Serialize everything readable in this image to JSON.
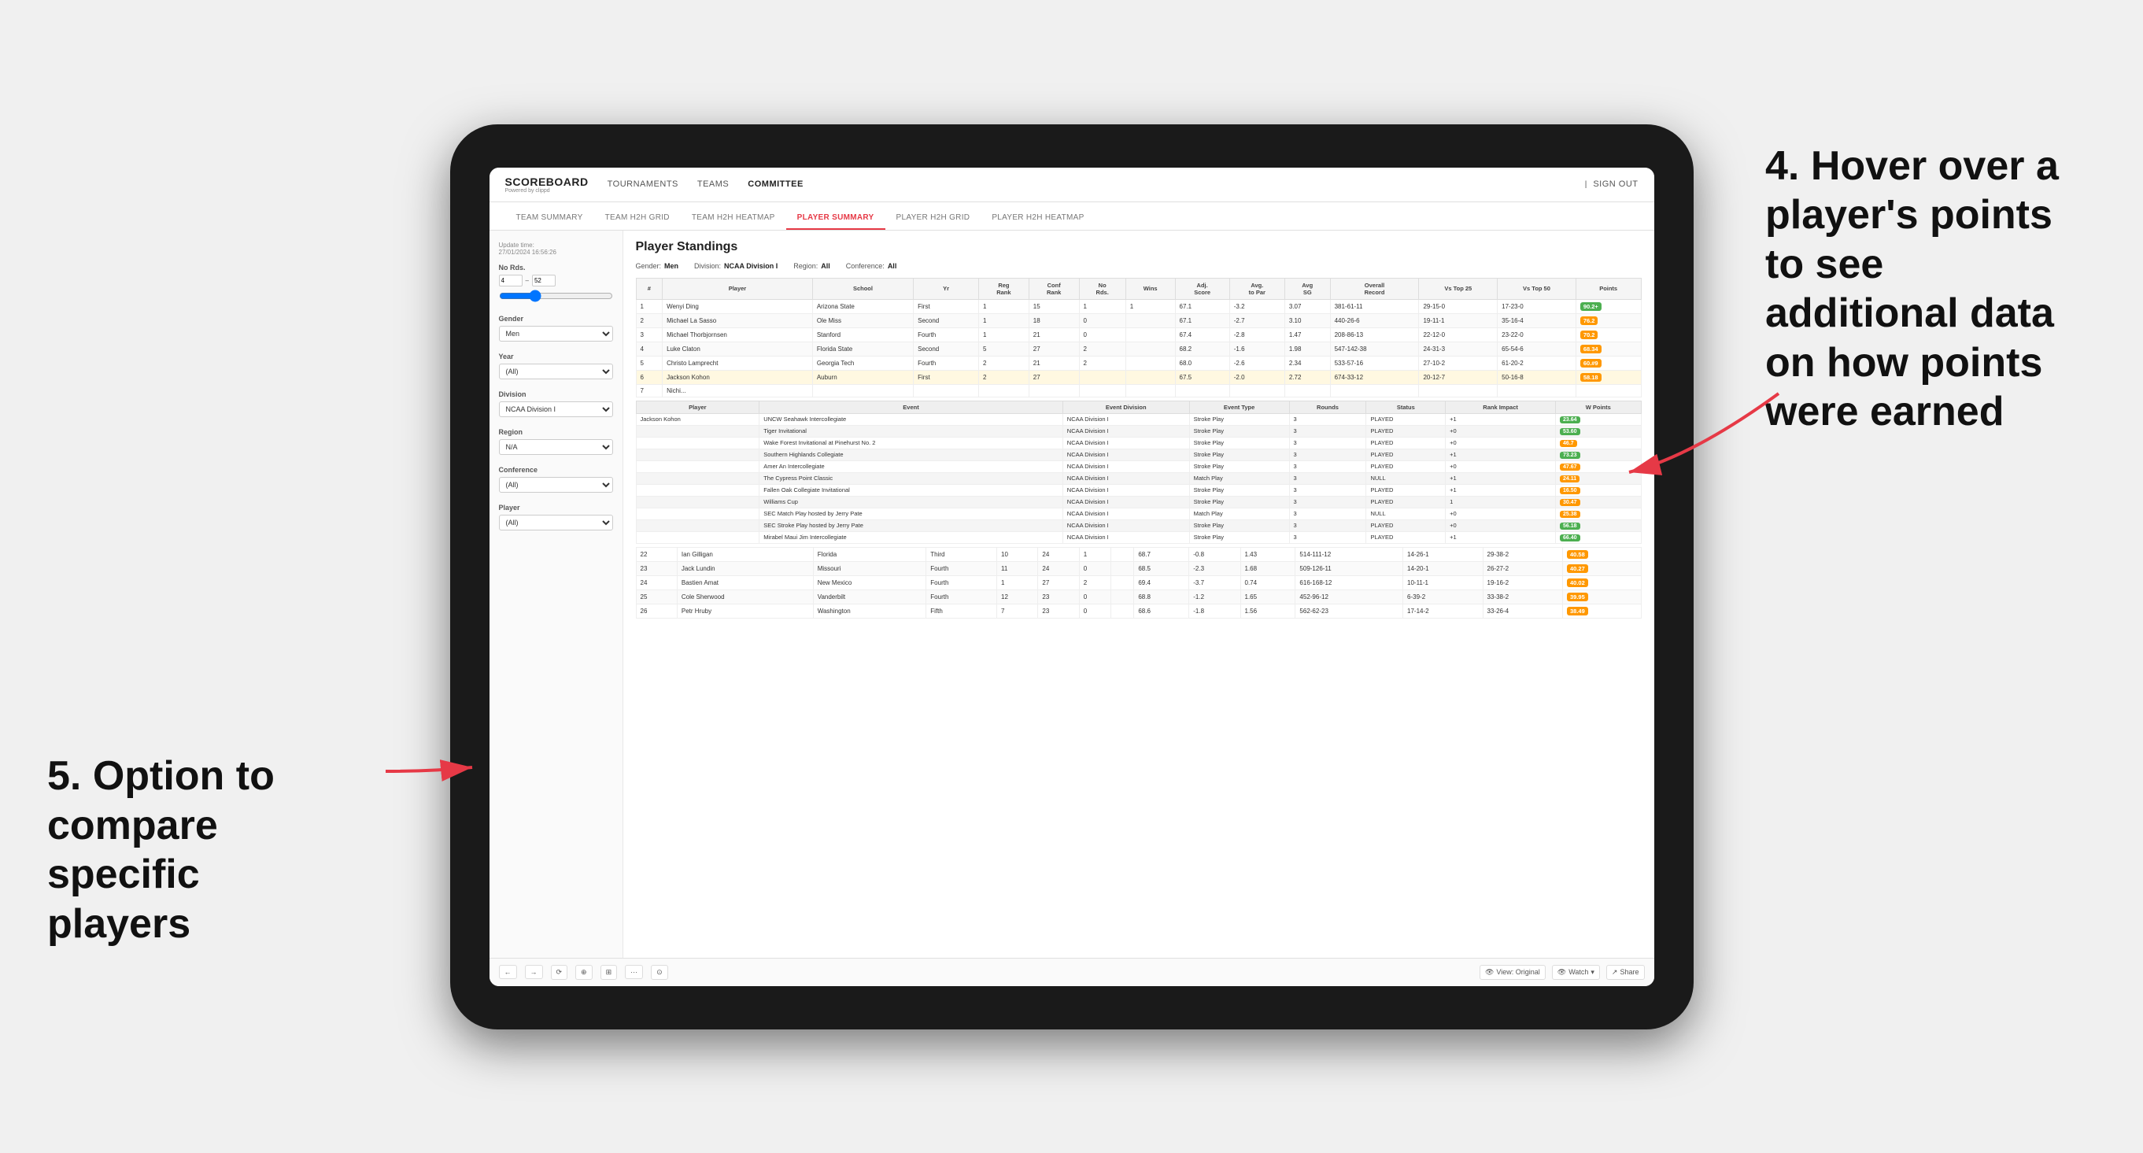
{
  "annotations": {
    "right": {
      "line1": "4. Hover over a",
      "line2": "player's points",
      "line3": "to see",
      "line4": "additional data",
      "line5": "on how points",
      "line6": "were earned"
    },
    "left": {
      "line1": "5. Option to",
      "line2": "compare",
      "line3": "specific players"
    }
  },
  "nav": {
    "logo": "SCOREBOARD",
    "logo_sub": "Powered by clippd",
    "links": [
      "TOURNAMENTS",
      "TEAMS",
      "COMMITTEE"
    ],
    "active_link": "COMMITTEE",
    "sign_out": "Sign out"
  },
  "sub_tabs": {
    "tabs": [
      "TEAM SUMMARY",
      "TEAM H2H GRID",
      "TEAM H2H HEATMAP",
      "PLAYER SUMMARY",
      "PLAYER H2H GRID",
      "PLAYER H2H HEATMAP"
    ],
    "active": "PLAYER SUMMARY"
  },
  "sidebar": {
    "update_time_label": "Update time:",
    "update_time_value": "27/01/2024 16:56:26",
    "no_rds_label": "No Rds.",
    "range_min": "4",
    "range_max": "52",
    "gender_label": "Gender",
    "gender_value": "Men",
    "year_label": "Year",
    "year_value": "(All)",
    "division_label": "Division",
    "division_value": "NCAA Division I",
    "region_label": "Region",
    "region_value": "N/A",
    "conference_label": "Conference",
    "conference_value": "(All)",
    "player_label": "Player",
    "player_value": "(All)"
  },
  "main": {
    "title": "Player Standings",
    "filters": {
      "gender_label": "Gender:",
      "gender_val": "Men",
      "division_label": "Division:",
      "division_val": "NCAA Division I",
      "region_label": "Region:",
      "region_val": "All",
      "conference_label": "Conference:",
      "conference_val": "All"
    },
    "table_headers": [
      "#",
      "Player",
      "School",
      "Yr",
      "Reg Rank",
      "Conf Rank",
      "No Rds.",
      "Wins",
      "Adj. Score",
      "Avg to Par",
      "Avg SG",
      "Overall Record",
      "Vs Top 25",
      "Vs Top 50",
      "Points"
    ],
    "rows": [
      {
        "num": "1",
        "player": "Wenyi Ding",
        "school": "Arizona State",
        "yr": "First",
        "reg_rank": "1",
        "conf_rank": "15",
        "no_rds": "1",
        "wins": "1",
        "adj_score": "67.1",
        "to_par": "-3.2",
        "avg_sg": "3.07",
        "record": "381-61-11",
        "vs25": "29-15-0",
        "vs50": "17-23-0",
        "points": "90.2+",
        "pts_color": "green"
      },
      {
        "num": "2",
        "player": "Michael La Sasso",
        "school": "Ole Miss",
        "yr": "Second",
        "reg_rank": "1",
        "conf_rank": "18",
        "no_rds": "0",
        "wins": "",
        "adj_score": "67.1",
        "to_par": "-2.7",
        "avg_sg": "3.10",
        "record": "440-26-6",
        "vs25": "19-11-1",
        "vs50": "35-16-4",
        "points": "76.2",
        "pts_color": "orange"
      },
      {
        "num": "3",
        "player": "Michael Thorbjornsen",
        "school": "Stanford",
        "yr": "Fourth",
        "reg_rank": "1",
        "conf_rank": "21",
        "no_rds": "0",
        "wins": "",
        "adj_score": "67.4",
        "to_par": "-2.8",
        "avg_sg": "1.47",
        "record": "208-86-13",
        "vs25": "22-12-0",
        "vs50": "23-22-0",
        "points": "70.2",
        "pts_color": "orange"
      },
      {
        "num": "4",
        "player": "Luke Claton",
        "school": "Florida State",
        "yr": "Second",
        "reg_rank": "5",
        "conf_rank": "27",
        "no_rds": "2",
        "wins": "",
        "adj_score": "68.2",
        "to_par": "-1.6",
        "avg_sg": "1.98",
        "record": "547-142-38",
        "vs25": "24-31-3",
        "vs50": "65-54-6",
        "points": "68.34",
        "pts_color": "orange"
      },
      {
        "num": "5",
        "player": "Christo Lamprecht",
        "school": "Georgia Tech",
        "yr": "Fourth",
        "reg_rank": "2",
        "conf_rank": "21",
        "no_rds": "2",
        "wins": "",
        "adj_score": "68.0",
        "to_par": "-2.6",
        "avg_sg": "2.34",
        "record": "533-57-16",
        "vs25": "27-10-2",
        "vs50": "61-20-2",
        "points": "60.#9",
        "pts_color": "orange"
      },
      {
        "num": "6",
        "player": "Jackson Kohon",
        "school": "Auburn",
        "yr": "First",
        "reg_rank": "2",
        "conf_rank": "27",
        "no_rds": "",
        "wins": "",
        "adj_score": "67.5",
        "to_par": "-2.0",
        "avg_sg": "2.72",
        "record": "674-33-12",
        "vs25": "20-12-7",
        "vs50": "50-16-8",
        "points": "58.18",
        "pts_color": "orange"
      }
    ],
    "event_section_header_player": "Jackson Kohon",
    "event_headers": [
      "Player",
      "Event",
      "Event Division",
      "Event Type",
      "Rounds",
      "Status",
      "Rank Impact",
      "W Points"
    ],
    "event_rows": [
      {
        "player": "Jackson Kohon",
        "event": "UNCW Seahawk Intercollegiate",
        "division": "NCAA Division I",
        "type": "Stroke Play",
        "rounds": "3",
        "status": "PLAYED",
        "rank": "+1",
        "wpoints": "23.64",
        "wpts_color": "green"
      },
      {
        "player": "",
        "event": "Tiger Invitational",
        "division": "NCAA Division I",
        "type": "Stroke Play",
        "rounds": "3",
        "status": "PLAYED",
        "rank": "+0",
        "wpoints": "53.60",
        "wpts_color": "green"
      },
      {
        "player": "",
        "event": "Wake Forest Invitational at Pinehurst No. 2",
        "division": "NCAA Division I",
        "type": "Stroke Play",
        "rounds": "3",
        "status": "PLAYED",
        "rank": "+0",
        "wpoints": "46.7",
        "wpts_color": "orange"
      },
      {
        "player": "",
        "event": "Southern Highlands Collegiate",
        "division": "NCAA Division I",
        "type": "Stroke Play",
        "rounds": "3",
        "status": "PLAYED",
        "rank": "+1",
        "wpoints": "73.23",
        "wpts_color": "green"
      },
      {
        "player": "",
        "event": "Amer An Intercollegiate",
        "division": "NCAA Division I",
        "type": "Stroke Play",
        "rounds": "3",
        "status": "PLAYED",
        "rank": "+0",
        "wpoints": "47.67",
        "wpts_color": "orange"
      },
      {
        "player": "",
        "event": "The Cypress Point Classic",
        "division": "NCAA Division I",
        "type": "Match Play",
        "rounds": "3",
        "status": "NULL",
        "rank": "+1",
        "wpoints": "24.11",
        "wpts_color": "orange"
      },
      {
        "player": "",
        "event": "Fallen Oak Collegiate Invitational",
        "division": "NCAA Division I",
        "type": "Stroke Play",
        "rounds": "3",
        "status": "PLAYED",
        "rank": "+1",
        "wpoints": "16.50",
        "wpts_color": "orange"
      },
      {
        "player": "",
        "event": "Williams Cup",
        "division": "NCAA Division I",
        "type": "Stroke Play",
        "rounds": "3",
        "status": "PLAYED",
        "rank": "1",
        "wpoints": "30.47",
        "wpts_color": "orange"
      },
      {
        "player": "",
        "event": "SEC Match Play hosted by Jerry Pate",
        "division": "NCAA Division I",
        "type": "Match Play",
        "rounds": "3",
        "status": "NULL",
        "rank": "+0",
        "wpoints": "25.38",
        "wpts_color": "orange"
      },
      {
        "player": "",
        "event": "SEC Stroke Play hosted by Jerry Pate",
        "division": "NCAA Division I",
        "type": "Stroke Play",
        "rounds": "3",
        "status": "PLAYED",
        "rank": "+0",
        "wpoints": "56.18",
        "wpts_color": "green"
      },
      {
        "player": "",
        "event": "Mirabel Maui Jim Intercollegiate",
        "division": "NCAA Division I",
        "type": "Stroke Play",
        "rounds": "3",
        "status": "PLAYED",
        "rank": "+1",
        "wpoints": "66.40",
        "wpts_color": "green"
      }
    ],
    "more_rows": [
      {
        "num": "22",
        "player": "Ian Gilligan",
        "school": "Florida",
        "yr": "Third",
        "reg_rank": "10",
        "conf_rank": "24",
        "no_rds": "1",
        "wins": "",
        "adj_score": "68.7",
        "to_par": "-0.8",
        "avg_sg": "1.43",
        "record": "514-111-12",
        "vs25": "14-26-1",
        "vs50": "29-38-2",
        "points": "40.58",
        "pts_color": "orange"
      },
      {
        "num": "23",
        "player": "Jack Lundin",
        "school": "Missouri",
        "yr": "Fourth",
        "reg_rank": "11",
        "conf_rank": "24",
        "no_rds": "0",
        "wins": "",
        "adj_score": "68.5",
        "to_par": "-2.3",
        "avg_sg": "1.68",
        "record": "509-126-11",
        "vs25": "14-20-1",
        "vs50": "26-27-2",
        "points": "40.27",
        "pts_color": "orange"
      },
      {
        "num": "24",
        "player": "Bastien Amat",
        "school": "New Mexico",
        "yr": "Fourth",
        "reg_rank": "1",
        "conf_rank": "27",
        "no_rds": "2",
        "wins": "",
        "adj_score": "69.4",
        "to_par": "-3.7",
        "avg_sg": "0.74",
        "record": "616-168-12",
        "vs25": "10-11-1",
        "vs50": "19-16-2",
        "points": "40.02",
        "pts_color": "orange"
      },
      {
        "num": "25",
        "player": "Cole Sherwood",
        "school": "Vanderbilt",
        "yr": "Fourth",
        "reg_rank": "12",
        "conf_rank": "23",
        "no_rds": "0",
        "wins": "",
        "adj_score": "68.8",
        "to_par": "-1.2",
        "avg_sg": "1.65",
        "record": "452-96-12",
        "vs25": "6-39-2",
        "vs50": "33-38-2",
        "points": "39.95",
        "pts_color": "orange"
      },
      {
        "num": "26",
        "player": "Petr Hruby",
        "school": "Washington",
        "yr": "Fifth",
        "reg_rank": "7",
        "conf_rank": "23",
        "no_rds": "0",
        "wins": "",
        "adj_score": "68.6",
        "to_par": "-1.8",
        "avg_sg": "1.56",
        "record": "562-62-23",
        "vs25": "17-14-2",
        "vs50": "33-26-4",
        "points": "38.49",
        "pts_color": "orange"
      }
    ]
  },
  "toolbar": {
    "btns": [
      "←",
      "→",
      "⟳",
      "⊕",
      "⊞",
      "·",
      "⊙"
    ],
    "view_label": "View: Original",
    "watch_label": "Watch",
    "share_label": "Share"
  }
}
